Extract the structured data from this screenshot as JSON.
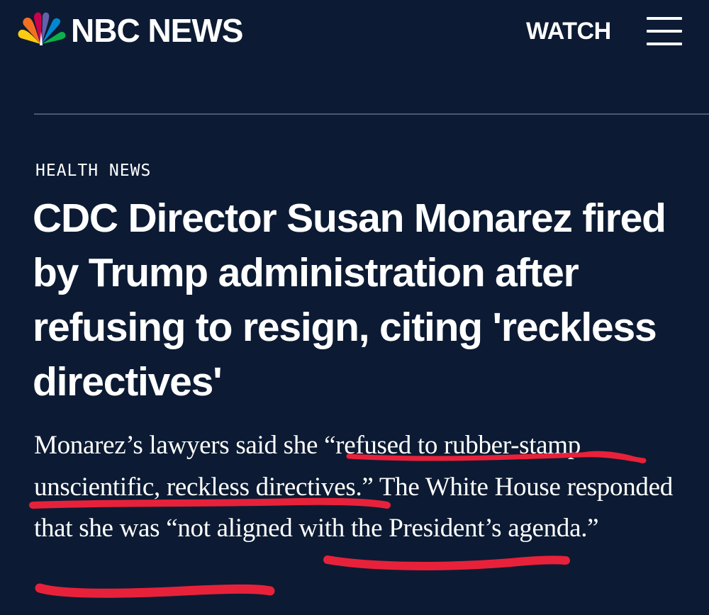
{
  "header": {
    "logo_text": "NBC NEWS",
    "watch_label": "WATCH",
    "menu_icon": "hamburger-menu-icon",
    "logo_icon": "nbc-peacock-icon"
  },
  "article": {
    "category": "HEALTH NEWS",
    "headline": "CDC Director Susan Monarez fired by Trump administration after refusing to resign, citing 'reckless directives'",
    "dek": {
      "part1": "Monarez’s lawyers said she ",
      "quote1": "“refused to rubber-stamp unscientific, reckless directives.”",
      "part2": " The White House responded that she was ",
      "quote2": "“not aligned with the President’s agenda.”"
    }
  },
  "colors": {
    "background": "#0c1b33",
    "text": "#ffffff",
    "divider": "#4a5873",
    "annotation": "#e8213a"
  }
}
